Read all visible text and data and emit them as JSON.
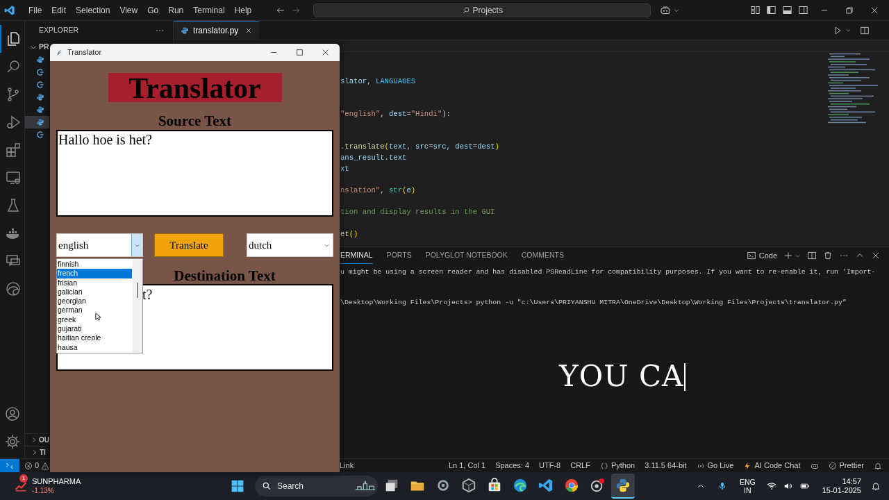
{
  "title_bar": {
    "menu": [
      "File",
      "Edit",
      "Selection",
      "View",
      "Go",
      "Run",
      "Terminal",
      "Help"
    ],
    "search": "Projects"
  },
  "activity_bar": {
    "items": [
      {
        "kind": "explorer",
        "selected": true
      },
      {
        "kind": "search",
        "selected": false
      },
      {
        "kind": "source-control",
        "selected": false
      },
      {
        "kind": "run-debug",
        "selected": false
      },
      {
        "kind": "extensions",
        "selected": false
      },
      {
        "kind": "remote",
        "selected": false
      },
      {
        "kind": "testing",
        "selected": false
      },
      {
        "kind": "docker",
        "selected": false
      },
      {
        "kind": "chat",
        "selected": false
      },
      {
        "kind": "edge",
        "selected": false
      }
    ],
    "bottom": [
      {
        "kind": "account"
      },
      {
        "kind": "settings"
      }
    ]
  },
  "sidebar": {
    "title": "EXPLORER",
    "section": "PR",
    "files": [
      {
        "kind": "python",
        "selected": false
      },
      {
        "kind": "git",
        "selected": false
      },
      {
        "kind": "git",
        "selected": false
      },
      {
        "kind": "python",
        "selected": false
      },
      {
        "kind": "python",
        "selected": false
      },
      {
        "kind": "python",
        "selected": true
      },
      {
        "kind": "git",
        "selected": false
      }
    ],
    "panels": [
      "OU",
      "TI"
    ]
  },
  "editor": {
    "tabs": [
      {
        "label": "translator.py",
        "selected": true
      }
    ],
    "lines": [
      {
        "kind": "code",
        "tokens": [
          {
            "kind": "var",
            "text": "slator"
          },
          {
            "kind": "punct",
            "text": ", "
          },
          {
            "kind": "const",
            "text": "LANGUAGES"
          }
        ]
      },
      {
        "kind": "blank"
      },
      {
        "kind": "blank"
      },
      {
        "kind": "code",
        "tokens": [
          {
            "kind": "string",
            "text": "\"english\""
          },
          {
            "kind": "punct",
            "text": ", "
          },
          {
            "kind": "var",
            "text": "dest"
          },
          {
            "kind": "punct",
            "text": "="
          },
          {
            "kind": "string",
            "text": "\"Hindi\""
          },
          {
            "kind": "punct",
            "text": "):"
          }
        ]
      },
      {
        "kind": "blank"
      },
      {
        "kind": "blank"
      },
      {
        "kind": "code",
        "tokens": [
          {
            "kind": "punct",
            "text": "."
          },
          {
            "kind": "func",
            "text": "translate"
          },
          {
            "kind": "bracket",
            "text": "("
          },
          {
            "kind": "var",
            "text": "text"
          },
          {
            "kind": "punct",
            "text": ", "
          },
          {
            "kind": "var",
            "text": "src"
          },
          {
            "kind": "punct",
            "text": "="
          },
          {
            "kind": "var",
            "text": "src"
          },
          {
            "kind": "punct",
            "text": ", "
          },
          {
            "kind": "var",
            "text": "dest"
          },
          {
            "kind": "punct",
            "text": "="
          },
          {
            "kind": "var",
            "text": "dest"
          },
          {
            "kind": "bracket",
            "text": ")"
          }
        ]
      },
      {
        "kind": "code",
        "tokens": [
          {
            "kind": "var",
            "text": "ans_result"
          },
          {
            "kind": "punct",
            "text": "."
          },
          {
            "kind": "var",
            "text": "text"
          }
        ]
      },
      {
        "kind": "code",
        "tokens": [
          {
            "kind": "var",
            "text": "xt"
          }
        ]
      },
      {
        "kind": "blank"
      },
      {
        "kind": "code",
        "tokens": [
          {
            "kind": "string",
            "text": "nslation\""
          },
          {
            "kind": "punct",
            "text": ", "
          },
          {
            "kind": "class",
            "text": "str"
          },
          {
            "kind": "bracket",
            "text": "("
          },
          {
            "kind": "var",
            "text": "e"
          },
          {
            "kind": "bracket",
            "text": ")"
          }
        ]
      },
      {
        "kind": "blank"
      },
      {
        "kind": "code",
        "tokens": [
          {
            "kind": "comment",
            "text": "tion and display results in the GUI"
          }
        ]
      },
      {
        "kind": "blank"
      },
      {
        "kind": "code",
        "tokens": [
          {
            "kind": "func",
            "text": "et"
          },
          {
            "kind": "bracket",
            "text": "()"
          }
        ]
      }
    ]
  },
  "panel": {
    "tabs": [
      {
        "label": "ERMINAL",
        "selected": true
      },
      {
        "label": "PORTS",
        "selected": false
      },
      {
        "label": "POLYGLOT NOTEBOOK",
        "selected": false
      },
      {
        "label": "COMMENTS",
        "selected": false
      }
    ],
    "profile": "Code",
    "lines": [
      {
        "kind": "output",
        "text": "u might be using a screen reader and has disabled PSReadLine for compatibility purposes. If you want to re-enable it, run 'Import-"
      },
      {
        "kind": "blank"
      },
      {
        "kind": "output",
        "text": "\\Desktop\\Working Files\\Projects> python -u \"c:\\Users\\PRIYANSHU MITRA\\OneDrive\\Desktop\\Working Files\\Projects\\translator.py\""
      }
    ],
    "caption": "YOU CA"
  },
  "status_bar": {
    "errors": "0",
    "link": "Link",
    "items": [
      {
        "kind": "text",
        "text": "Ln 1, Col 1"
      },
      {
        "kind": "text",
        "text": "Spaces: 4"
      },
      {
        "kind": "text",
        "text": "UTF-8"
      },
      {
        "kind": "text",
        "text": "CRLF"
      },
      {
        "kind": "language",
        "text": "Python"
      },
      {
        "kind": "text",
        "text": "3.11.5 64-bit"
      },
      {
        "kind": "live",
        "text": "Go Live"
      },
      {
        "kind": "ai",
        "text": "AI Code Chat"
      },
      {
        "kind": "copilot"
      },
      {
        "kind": "prettier",
        "text": "Prettier"
      },
      {
        "kind": "notifications"
      }
    ]
  },
  "translator_window": {
    "title": "Translator",
    "heading": "Translator",
    "source_label": "Source Text",
    "source_text": "Hallo hoe is het?",
    "source_language": "english",
    "button": "Translate",
    "dest_language": "dutch",
    "dest_label": "Destination Text",
    "dest_text": "t?",
    "dropdown": [
      {
        "label": "finnish",
        "selected": false
      },
      {
        "label": "french",
        "selected": true
      },
      {
        "label": "frisian",
        "selected": false
      },
      {
        "label": "galician",
        "selected": false
      },
      {
        "label": "georgian",
        "selected": false
      },
      {
        "label": "german",
        "selected": false
      },
      {
        "label": "greek",
        "selected": false
      },
      {
        "label": "gujarati",
        "selected": false
      },
      {
        "label": "haitian creole",
        "selected": false
      },
      {
        "label": "hausa",
        "selected": false
      }
    ]
  },
  "taskbar": {
    "stock": {
      "badge": "1",
      "name": "SUNPHARMA",
      "change": "-1.13%"
    },
    "search": "Search",
    "apps": [
      {
        "kind": "task-view",
        "selected": false
      },
      {
        "kind": "folder",
        "selected": false
      },
      {
        "kind": "settings",
        "selected": false
      },
      {
        "kind": "cube",
        "selected": false
      },
      {
        "kind": "store",
        "selected": false
      },
      {
        "kind": "edge",
        "selected": false
      },
      {
        "kind": "vscode",
        "selected": false
      },
      {
        "kind": "chrome",
        "selected": false
      },
      {
        "kind": "recorder",
        "selected": false
      },
      {
        "kind": "python",
        "selected": true
      }
    ],
    "tray": {
      "lang": "ENG",
      "region": "IN",
      "time": "14:57",
      "date": "15-01-2025"
    }
  }
}
